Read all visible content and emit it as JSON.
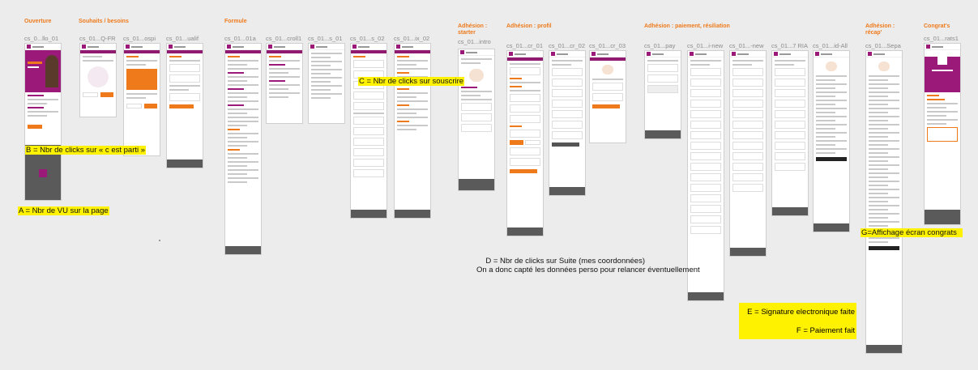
{
  "sections": {
    "ouverture": "Ouverture",
    "souhaits": "Souhaits / besoins",
    "formule": "Formule",
    "adhesion_starter": "Adhésion : starter",
    "adhesion_profil": "Adhésion : profil",
    "adhesion_paiement": "Adhésion : paiement, résiliation",
    "adhesion_recap": "Adhésion : récap'",
    "congrats": "Congrat's"
  },
  "screen_labels": {
    "s1": "cs_0...llo_01",
    "s2": "cs_01...Q-FR",
    "s3": "cs_01...ospi",
    "s4": "cs_01...ualif",
    "s5": "cs_01...01a",
    "s6": "cs_01...croll1",
    "s7": "cs_01...s_01",
    "s8": "cs_01...s_02",
    "s9": "cs_01...ix_02",
    "s10": "cs_01...intro",
    "s11": "cs_01...cr_01",
    "s12": "cs_01...cr_02",
    "s13": "cs_01...cr_03",
    "s14": "cs_01...pay",
    "s15": "cs_01...i-new",
    "s16": "cs_01...-new",
    "s17": "cs_01...7 RIA",
    "s18": "cs_01...id-All",
    "s19": "cs_01...Sepa",
    "s20": "cs_01...rats1"
  },
  "annotations": {
    "a": "A = Nbr de VU sur la page",
    "b": "B = Nbr de clicks sur « c est parti »",
    "c": "C = Nbr de clicks sur souscrire",
    "d1": "D = Nbr de clicks sur Suite (mes coordonnées)",
    "d2": "On a donc capté les données perso pour relancer éventuellement",
    "e": "E = Signature electronique faite",
    "f": "F = Paiement fait",
    "g": "G=Affichage écran congrats"
  },
  "colors": {
    "section_title": "#ee7a1c",
    "brand": "#9b1a79",
    "highlight": "#fff200",
    "board": "#ececec"
  }
}
